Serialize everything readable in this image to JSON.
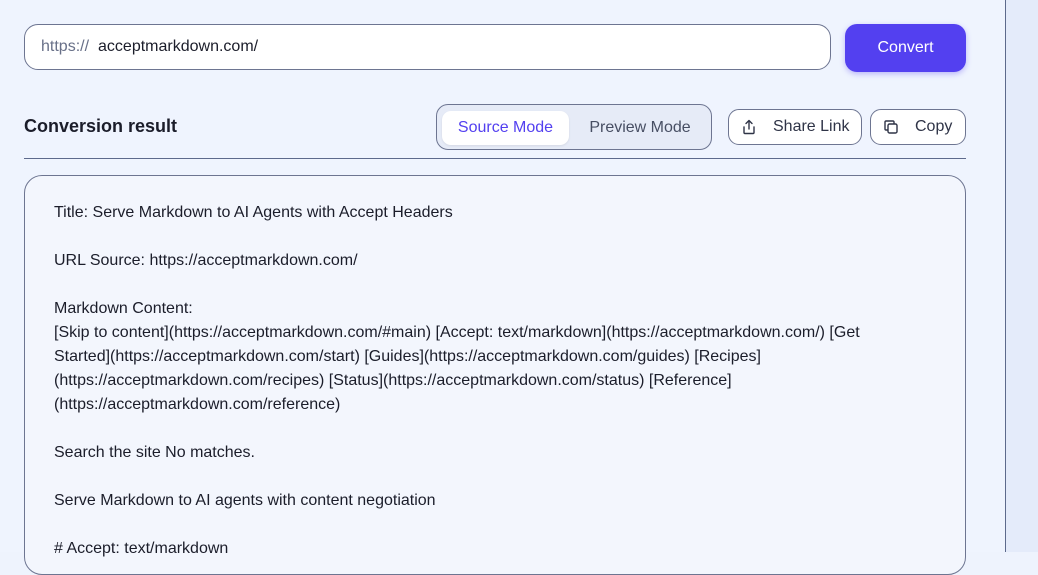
{
  "url_bar": {
    "prefix": "https://",
    "value": "acceptmarkdown.com/"
  },
  "convert_button": {
    "label": "Convert"
  },
  "result": {
    "title": "Conversion result",
    "modes": {
      "source_label": "Source Mode",
      "preview_label": "Preview Mode",
      "selected": "Source Mode"
    },
    "share_button": {
      "label": "Share Link",
      "icon": "share-icon"
    },
    "copy_button": {
      "label": "Copy",
      "icon": "copy-icon"
    }
  },
  "content": {
    "lines": [
      "Title: Serve Markdown to AI Agents with Accept Headers",
      "",
      "URL Source: https://acceptmarkdown.com/",
      "",
      "Markdown Content:",
      "[Skip to content](https://acceptmarkdown.com/#main) [Accept: text/markdown](https://acceptmarkdown.com/) [Get",
      "Started](https://acceptmarkdown.com/start) [Guides](https://acceptmarkdown.com/guides) [Recipes]",
      "(https://acceptmarkdown.com/recipes) [Status](https://acceptmarkdown.com/status) [Reference]",
      "(https://acceptmarkdown.com/reference)",
      "",
      "Search the site No matches.",
      "",
      "Serve Markdown to AI agents with content negotiation",
      "",
      "# Accept: text/markdown"
    ]
  },
  "colors": {
    "accent": "#5340f0",
    "background": "#eff4fe",
    "border": "#6d7591",
    "text": "#1b1d2a"
  }
}
